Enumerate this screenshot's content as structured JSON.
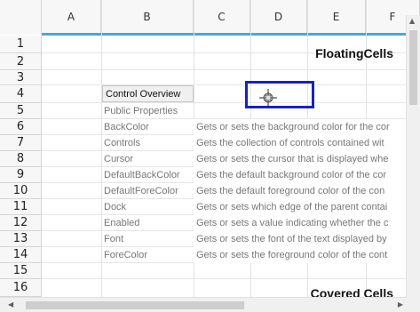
{
  "columns": [
    "A",
    "B",
    "C",
    "D",
    "E",
    "F"
  ],
  "rows": [
    "1",
    "2",
    "3",
    "4",
    "5",
    "6",
    "7",
    "8",
    "9",
    "10",
    "11",
    "12",
    "13",
    "14",
    "15",
    "16"
  ],
  "title_top": "FloatingCells",
  "title_bottom": "Covered Cells",
  "overview_label": "Control Overview",
  "public_properties_label": "Public Properties",
  "properties": [
    {
      "name": "BackColor",
      "description": "Gets or sets the background color for the cor"
    },
    {
      "name": "Controls",
      "description": "Gets the collection of controls contained wit"
    },
    {
      "name": "Cursor",
      "description": "Gets or sets the cursor that is displayed whe"
    },
    {
      "name": "DefaultBackColor",
      "description": "Gets the default background color of the cor"
    },
    {
      "name": "DefaultForeColor",
      "description": "Gets the default foreground color of the con"
    },
    {
      "name": "Dock",
      "description": "Gets or sets which edge of the parent contai"
    },
    {
      "name": "Enabled",
      "description": "Gets or sets a value indicating whether the c"
    },
    {
      "name": "Font",
      "description": "Gets or sets the font of the text displayed by"
    },
    {
      "name": "ForeColor",
      "description": "Gets or sets the foreground color of the cont"
    }
  ],
  "colors": {
    "header_bg": "#f7f7f7",
    "accent_line": "#5aa1c9",
    "selection_border": "#1a23b4"
  },
  "icons": {
    "cursor": "crosshair-cursor-icon",
    "scroll_up": "arrow-up-icon",
    "scroll_left": "arrow-left-icon",
    "scroll_right": "arrow-right-icon"
  }
}
